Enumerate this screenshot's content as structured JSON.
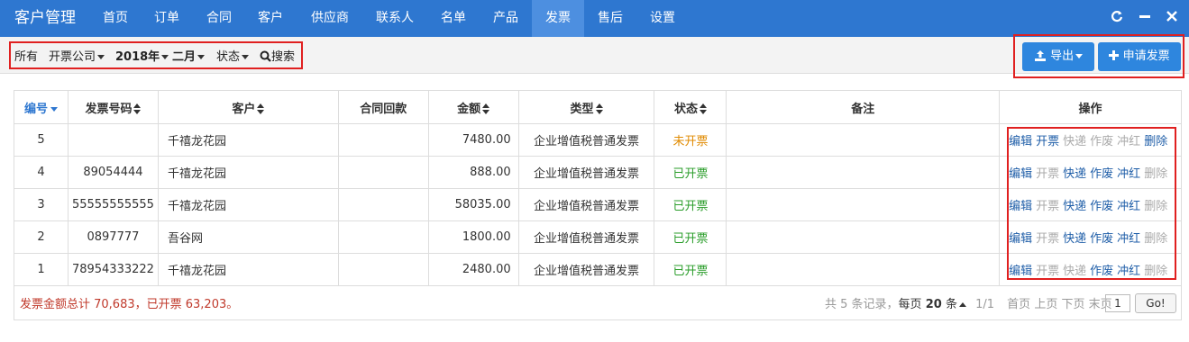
{
  "app": {
    "title": "客户管理"
  },
  "nav": [
    {
      "label": "首页"
    },
    {
      "label": "订单"
    },
    {
      "label": "合同"
    },
    {
      "label": "客户"
    },
    {
      "label": "供应商"
    },
    {
      "label": "联系人"
    },
    {
      "label": "名单"
    },
    {
      "label": "产品"
    },
    {
      "label": "发票",
      "active": true
    },
    {
      "label": "售后"
    },
    {
      "label": "设置"
    }
  ],
  "window_controls": {
    "refresh": "C",
    "minimize": "−",
    "close": "×"
  },
  "filters": {
    "all": "所有",
    "company": "开票公司",
    "year": "2018年",
    "month": "二月",
    "status": "状态",
    "search": "搜索"
  },
  "actions": {
    "export_label": "导出",
    "apply_label": "申请发票"
  },
  "table": {
    "headers": {
      "id": "编号",
      "invoice_no": "发票号码",
      "customer": "客户",
      "contract_payment": "合同回款",
      "amount": "金额",
      "type": "类型",
      "status": "状态",
      "remark": "备注",
      "ops": "操作"
    },
    "rows": [
      {
        "id": "5",
        "invoice_no": "",
        "customer": "千禧龙花园",
        "contract_payment": "",
        "amount": "7480.00",
        "type": "企业增值税普通发票",
        "status": "未开票",
        "remark": ""
      },
      {
        "id": "4",
        "invoice_no": "89054444",
        "customer": "千禧龙花园",
        "contract_payment": "",
        "amount": "888.00",
        "type": "企业增值税普通发票",
        "status": "已开票",
        "remark": ""
      },
      {
        "id": "3",
        "invoice_no": "55555555555",
        "customer": "千禧龙花园",
        "contract_payment": "",
        "amount": "58035.00",
        "type": "企业增值税普通发票",
        "status": "已开票",
        "remark": ""
      },
      {
        "id": "2",
        "invoice_no": "0897777",
        "customer": "吾谷网",
        "contract_payment": "",
        "amount": "1800.00",
        "type": "企业增值税普通发票",
        "status": "已开票",
        "remark": ""
      },
      {
        "id": "1",
        "invoice_no": "78954333222",
        "customer": "千禧龙花园",
        "contract_payment": "",
        "amount": "2480.00",
        "type": "企业增值税普通发票",
        "status": "已开票",
        "remark": ""
      }
    ],
    "op_labels": {
      "edit": "编辑",
      "issue": "开票",
      "express": "快递",
      "void": "作废",
      "reverse": "冲红",
      "delete": "删除"
    }
  },
  "footer": {
    "summary": "发票金额总计 70,683，已开票 63,203。",
    "total_prefix": "共 5 条记录，",
    "per_page_prefix": "每页",
    "per_page_value": "20",
    "per_page_suffix": "条",
    "page_info": "1/1",
    "first": "首页",
    "prev": "上页",
    "next": "下页",
    "last": "末页",
    "page_input": "1",
    "go": "Go!"
  },
  "colors": {
    "nav_bg": "#2e77d0",
    "nav_active": "#4d8fe0",
    "button": "#2e86de",
    "status_pending": "#e08a00",
    "status_done": "#2a9d2a",
    "highlight_box": "#e02020"
  }
}
